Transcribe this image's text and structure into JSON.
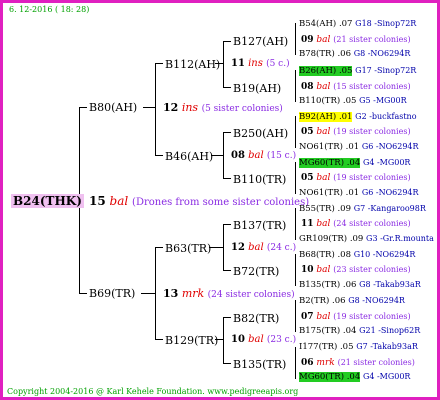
{
  "header": {
    "date": "6. 12-2016 ( 18: 28)"
  },
  "root": {
    "label": "B24(THK)"
  },
  "root_info": {
    "count": "15",
    "word": "bal",
    "note": "(Drones from some sister colonies)"
  },
  "gen1": [
    {
      "label": "B80(AH)",
      "count": "12",
      "word": "ins",
      "note": "(5 sister colonies)"
    },
    {
      "label": "B69(TR)",
      "count": "13",
      "word": "mrk",
      "note": "(24 sister colonies)"
    }
  ],
  "gen2": [
    {
      "label": "B112(AH)",
      "count": "11",
      "word": "ins",
      "note": "(5 c.)"
    },
    {
      "label": "B46(AH)",
      "count": "08",
      "word": "bal",
      "note": "(15 c.)"
    },
    {
      "label": "B63(TR)",
      "count": "12",
      "word": "bal",
      "note": "(24 c.)"
    },
    {
      "label": "B129(TR)",
      "count": "10",
      "word": "bal",
      "note": "(23 c.)"
    }
  ],
  "gen3": [
    {
      "label": "B127(AH)",
      "count": "09",
      "word": "bal",
      "note": "(21 sister colonies)"
    },
    {
      "label": "B19(AH)",
      "count": "08",
      "word": "bal",
      "note": "(15 sister colonies)"
    },
    {
      "label": "B250(AH)",
      "count": "05",
      "word": "bal",
      "note": "(19 sister colonies)"
    },
    {
      "label": "B110(TR)",
      "count": "05",
      "word": "bal",
      "note": "(19 sister colonies)"
    },
    {
      "label": "B137(TR)",
      "count": "11",
      "word": "bal",
      "note": "(24 sister colonies)"
    },
    {
      "label": "B72(TR)",
      "count": "10",
      "word": "bal",
      "note": "(23 sister colonies)"
    },
    {
      "label": "B82(TR)",
      "count": "07",
      "word": "bal",
      "note": "(19 sister colonies)"
    },
    {
      "label": "B135(TR)",
      "count": "06",
      "word": "mrk",
      "note": "(21 sister colonies)"
    }
  ],
  "gen4": [
    {
      "name": "B54(AH) .07",
      "code": "G18 -Sinop72R"
    },
    {
      "name": "B78(TR) .06",
      "code": "G8 -NO6294R"
    },
    {
      "name": "B26(AH) .05",
      "code": "G17 -Sinop72R"
    },
    {
      "name": "B110(TR) .05",
      "code": "G5 -MG00R"
    },
    {
      "name": "B92(AH) .01",
      "code": "G2 -buckfastno"
    },
    {
      "name": "NO61(TR) .01",
      "code": "G6 -NO6294R"
    },
    {
      "name": "MG60(TR) .04",
      "code": "G4 -MG00R"
    },
    {
      "name": "NO61(TR) .01",
      "code": "G6 -NO6294R"
    },
    {
      "name": "B55(TR) .09",
      "code": "G7 -Kangaroo98R"
    },
    {
      "name": "GR109(TR) .09",
      "code": "G3 -Gr.R.mounta"
    },
    {
      "name": "B68(TR) .08",
      "code": "G10 -NO6294R"
    },
    {
      "name": "B135(TR) .06",
      "code": "G8 -Takab93aR"
    },
    {
      "name": "B2(TR) .06",
      "code": "G8 -NO6294R"
    },
    {
      "name": "B175(TR) .04",
      "code": "G21 -Sinop62R"
    },
    {
      "name": "I177(TR) .05",
      "code": "G7 -Takab93aR"
    },
    {
      "name": "MG60(TR) .04",
      "code": "G4 -MG00R"
    }
  ],
  "footer": {
    "copyright": "Copyright 2004-2016 @ Karl Kehele Foundation.",
    "url": "www.pedigreeapis.org"
  },
  "colors": {
    "border": "#e020c0",
    "green": "#00a000",
    "blue": "#0000aa",
    "purple": "#8a2be2",
    "red": "#e00000",
    "highlight_green": "#22cc22",
    "highlight_yellow": "#ffff00",
    "root_bg": "#f0c0f0"
  }
}
